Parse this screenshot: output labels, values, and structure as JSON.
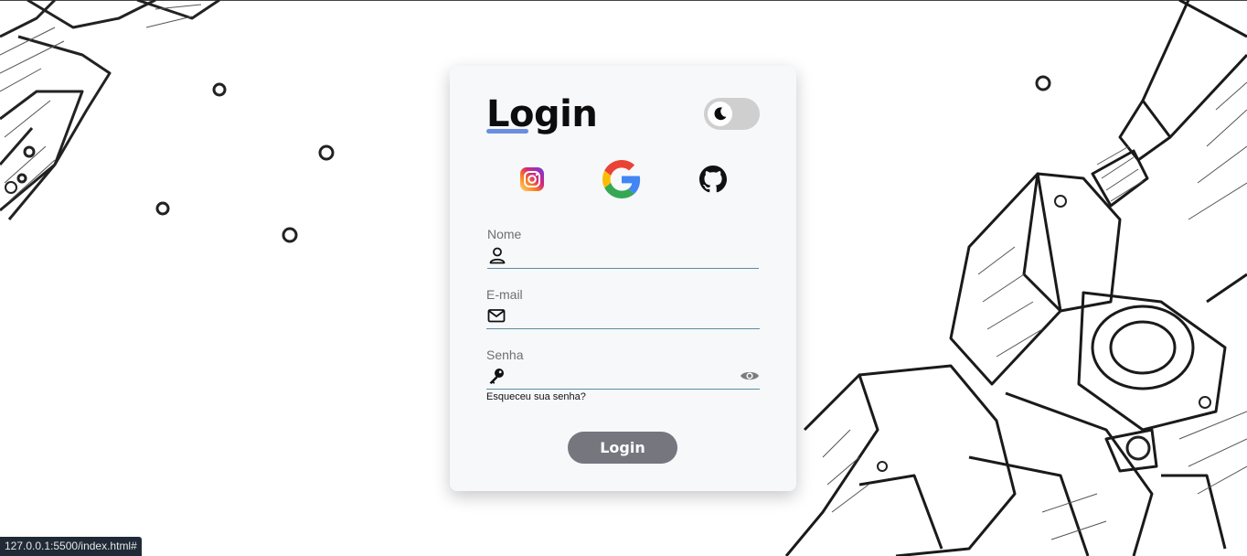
{
  "login": {
    "title": "Login",
    "theme_toggle": "dark-mode",
    "social": [
      {
        "name": "instagram",
        "icon": "instagram-icon"
      },
      {
        "name": "google",
        "icon": "google-icon"
      },
      {
        "name": "github",
        "icon": "github-icon"
      }
    ],
    "fields": {
      "name": {
        "label": "Nome",
        "value": "",
        "icon": "user-icon"
      },
      "email": {
        "label": "E-mail",
        "value": "",
        "icon": "envelope-icon"
      },
      "password": {
        "label": "Senha",
        "value": "",
        "icon": "key-icon",
        "toggle_icon": "eye-icon"
      }
    },
    "forgot_password": "Esqueceu sua senha?",
    "submit_label": "Login"
  },
  "status_url": "127.0.0.1:5500/index.html#",
  "colors": {
    "card_bg": "#f6f8fa",
    "accent_underline": "#6b8ee0",
    "input_line": "#5f8aa0",
    "button_bg": "#76767f",
    "toggle_bg": "#cfcfcf"
  }
}
